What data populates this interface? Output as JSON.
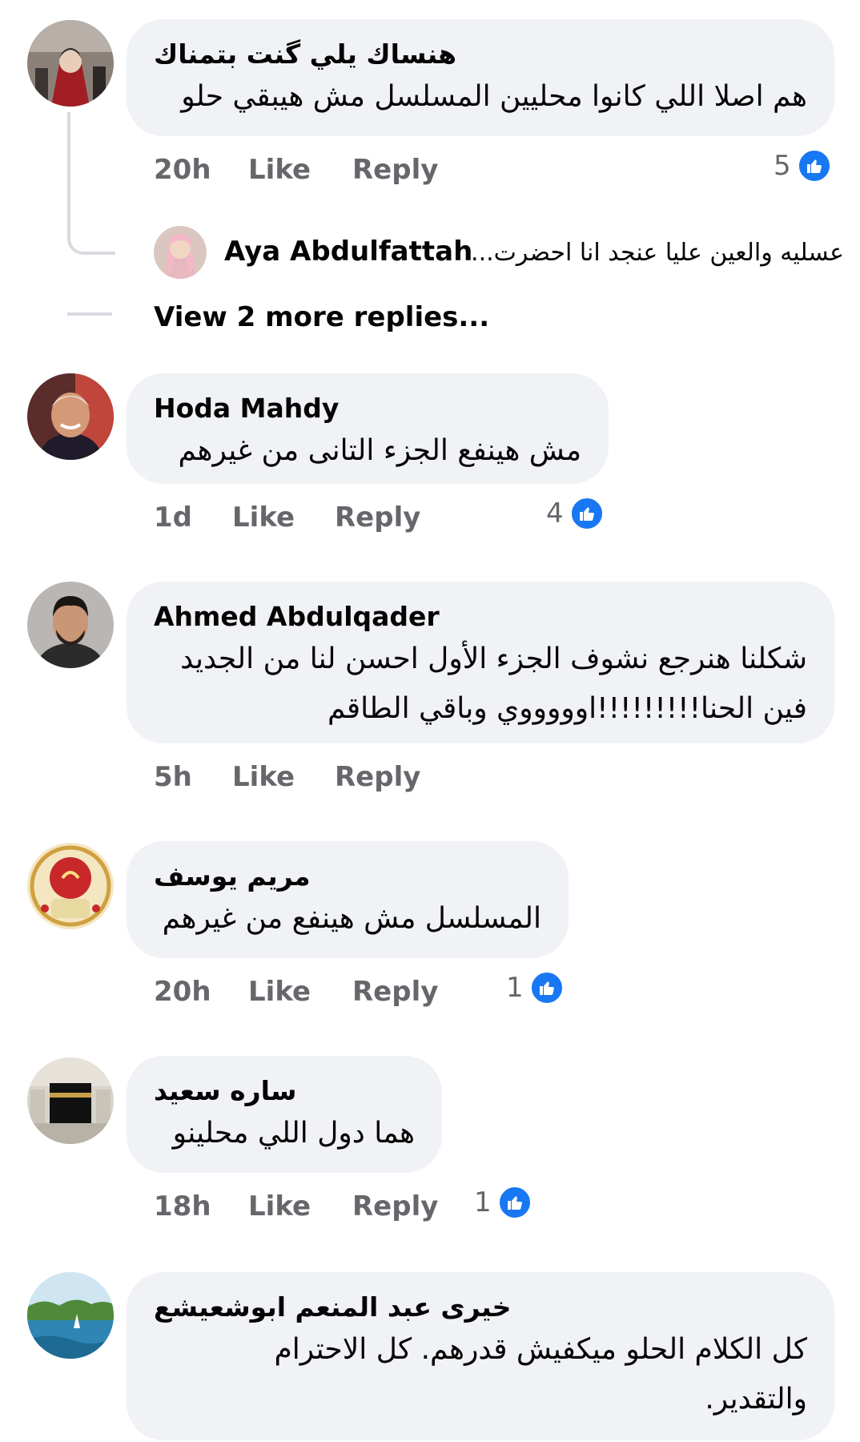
{
  "colors": {
    "bubble": "#f0f2f5",
    "text": "#050505",
    "secondary": "#65676b",
    "like": "#1877f2",
    "thread": "#d8dadf"
  },
  "comments": [
    {
      "name": "هنساك يلي گنت بتمناك",
      "lines": [
        "هم اصلا اللي كانوا محليين المسلسل مش هيبقي حلو"
      ],
      "time": "20h",
      "like": "Like",
      "reply": "Reply",
      "reactions": "5"
    },
    {
      "name": "Hoda Mahdy",
      "lines": [
        "مش هينفع الجزء التانى من غيرهم"
      ],
      "time": "1d",
      "like": "Like",
      "reply": "Reply",
      "reactions": "4"
    },
    {
      "name": "Ahmed Abdulqader",
      "lines": [
        "شكلنا هنرجع نشوف الجزء الأول احسن لنا من الجديد",
        "فين الحنا!!!!!!!!!اوووووي وباقي الطاقم"
      ],
      "time": "5h",
      "like": "Like",
      "reply": "Reply"
    },
    {
      "name": "مريم يوسف",
      "lines": [
        "المسلسل مش هينفع من غيرهم"
      ],
      "time": "20h",
      "like": "Like",
      "reply": "Reply",
      "reactions": "1"
    },
    {
      "name": "ساره سعيد",
      "lines": [
        "هما دول اللي محلينو"
      ],
      "time": "18h",
      "like": "Like",
      "reply": "Reply",
      "reactions": "1"
    },
    {
      "name": "خيرى عبد المنعم ابوشعيشع",
      "lines": [
        "كل الكلام الحلو ميكفيش قدرهم.   كل الاحترام",
        "والتقدير."
      ]
    }
  ],
  "reply_preview": {
    "name": "Aya Abdulfattah",
    "text": "عسليه والعين عليا عنجد انا احضرت..."
  },
  "view_more": "View 2 more replies...",
  "icons": {
    "like_badge": "thumbs-up-icon"
  }
}
